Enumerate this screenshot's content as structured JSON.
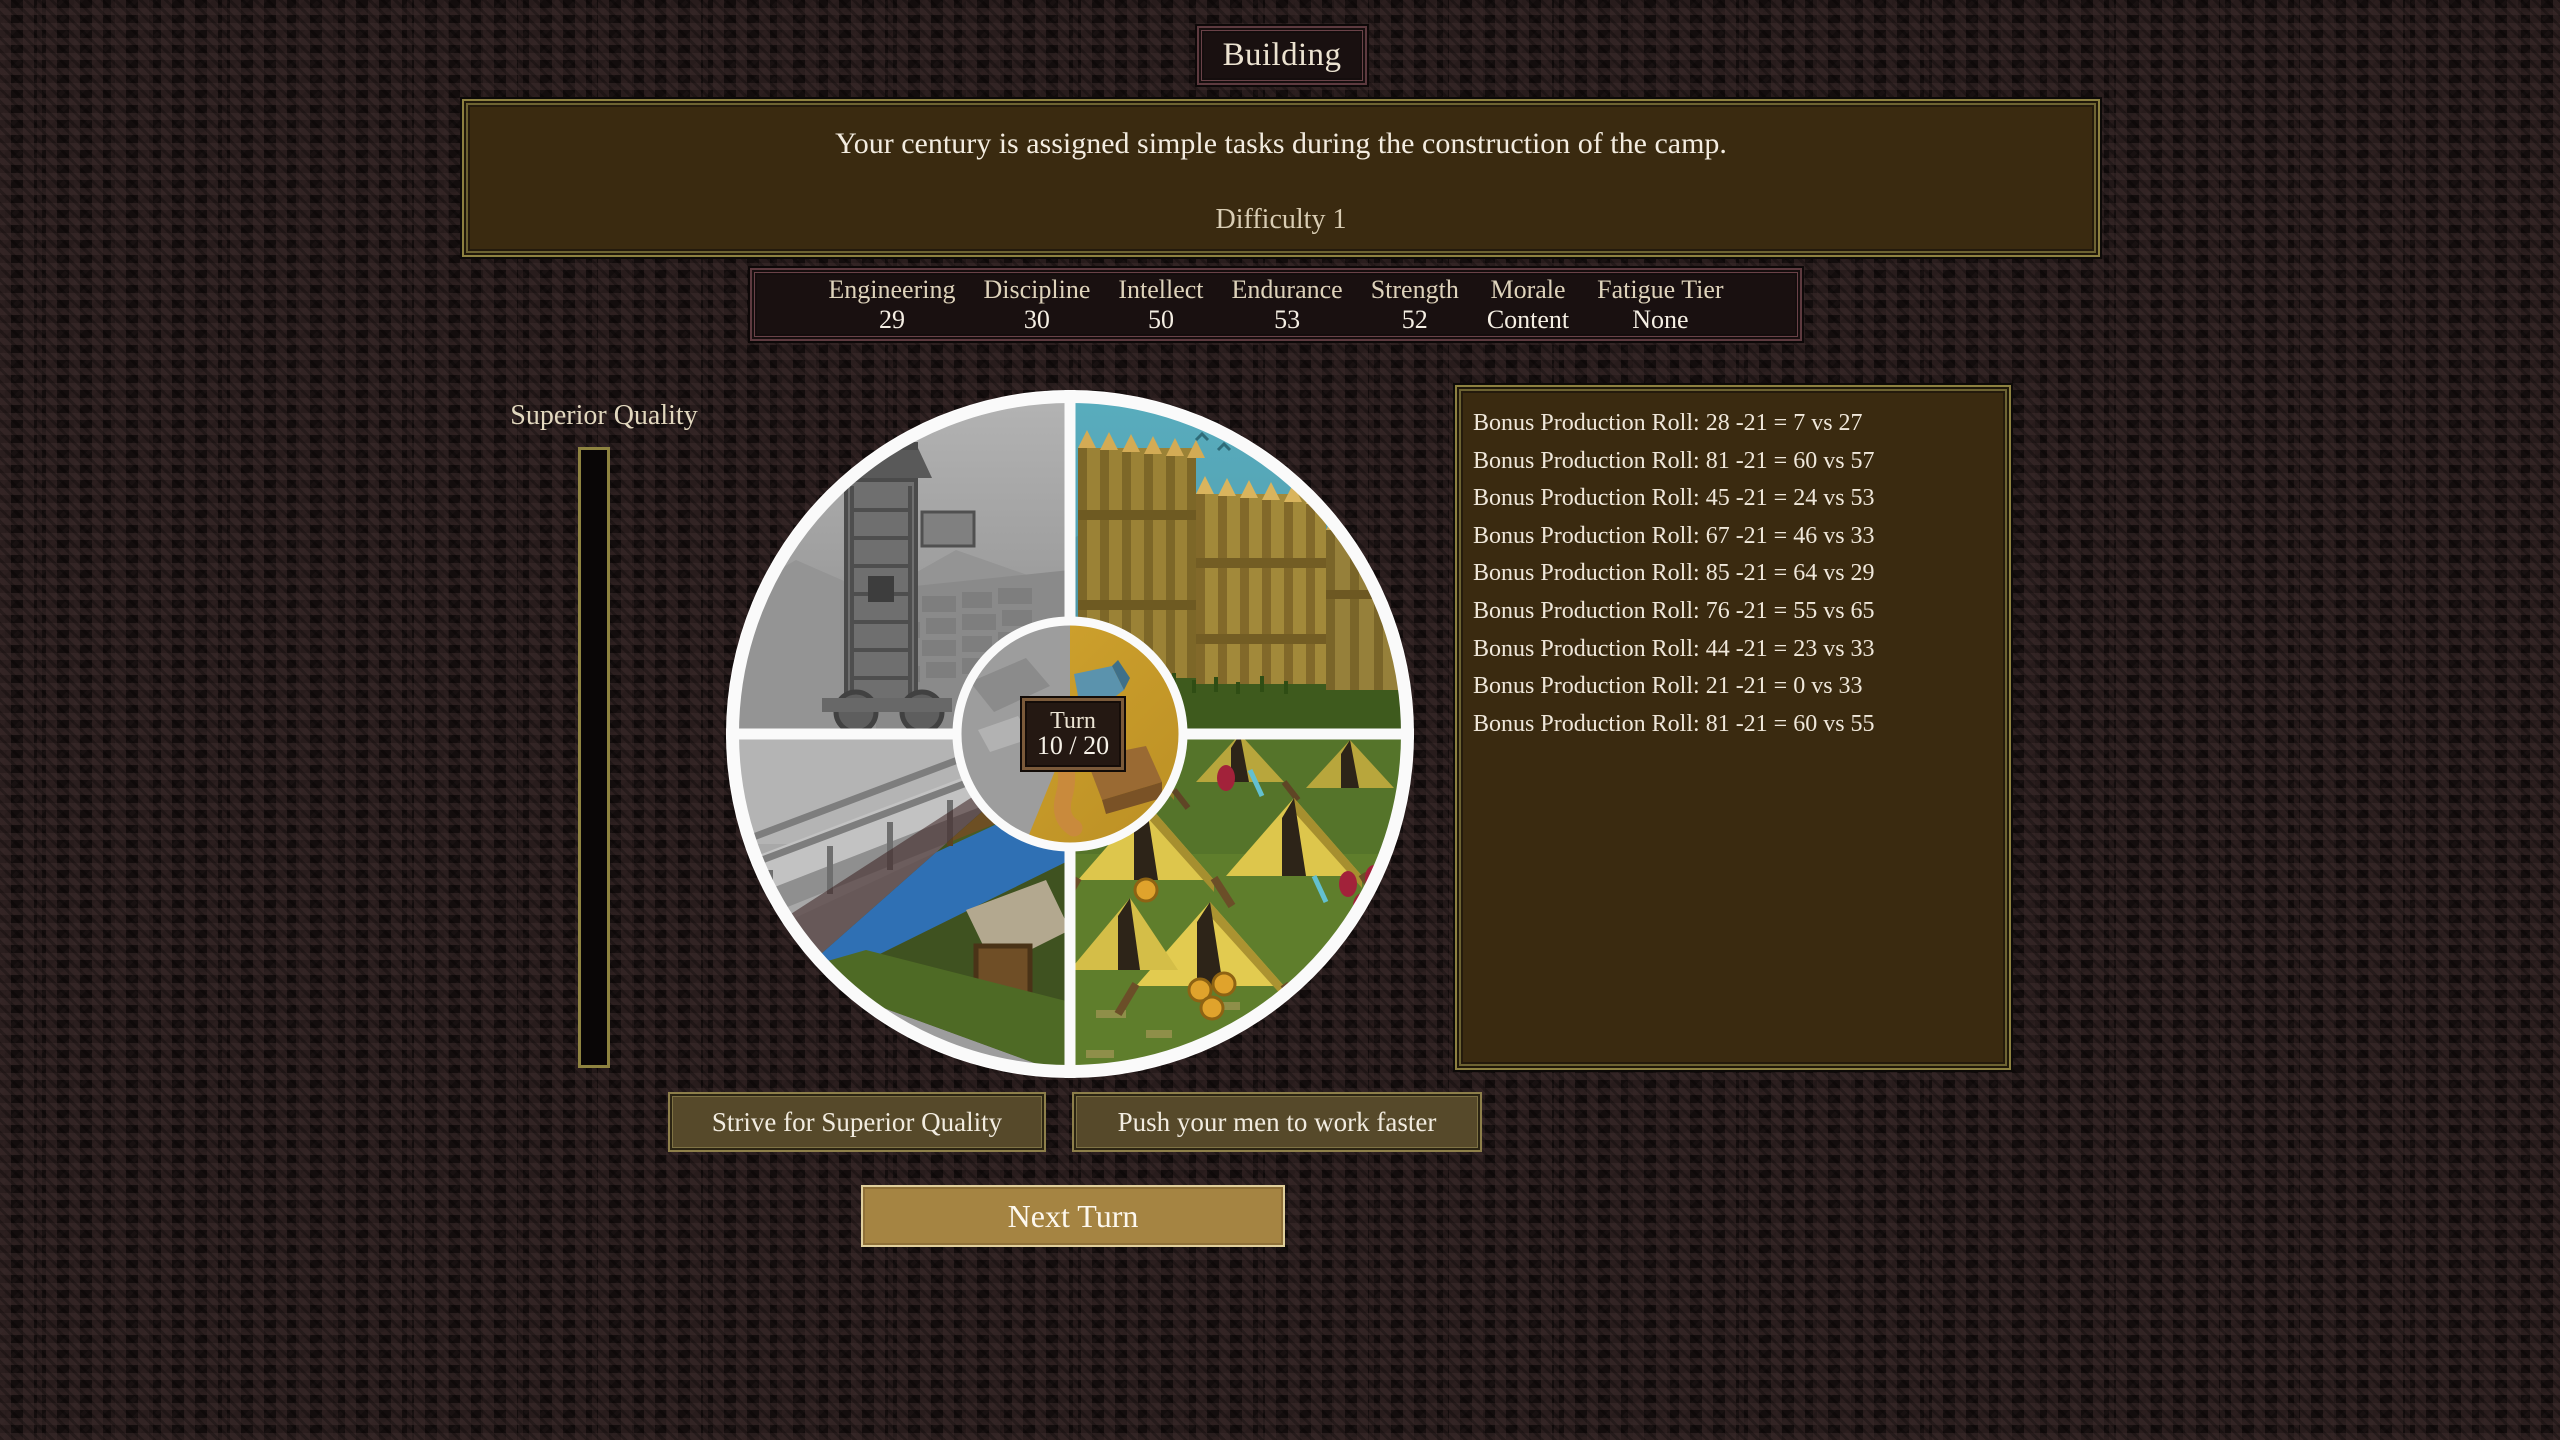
{
  "header": {
    "title": "Building"
  },
  "description": {
    "text": "Your century is assigned simple tasks during the construction of the camp.",
    "difficulty": "Difficulty 1"
  },
  "stats": {
    "columns": [
      {
        "name": "Engineering",
        "value": "29"
      },
      {
        "name": "Discipline",
        "value": "30"
      },
      {
        "name": "Intellect",
        "value": "50"
      },
      {
        "name": "Endurance",
        "value": "53"
      },
      {
        "name": "Strength",
        "value": "52"
      },
      {
        "name": "Morale",
        "value": "Content"
      },
      {
        "name": "Fatigue Tier",
        "value": "None"
      }
    ]
  },
  "quality_meter": {
    "label": "Superior Quality",
    "fill_percent": 0
  },
  "wheel": {
    "turn_word": "Turn",
    "turn_value": "10 / 20",
    "turn_current": 10,
    "turn_max": 20,
    "progress_percent": 54,
    "colors": {
      "ring": "#fafafa",
      "sky": "#5aa9b9",
      "grass": "#4c6b27",
      "tent": "#d9c44b",
      "center_gold": "#c69a2b",
      "stone": "#9a9a9a"
    }
  },
  "actions": {
    "quality": "Strive for Superior Quality",
    "faster": "Push your men to work faster",
    "next_turn": "Next Turn"
  },
  "log": {
    "lines": [
      "Bonus Production Roll: 28 -21 = 7 vs 27",
      "Bonus Production Roll: 81 -21 = 60 vs 57",
      "Bonus Production Roll: 45 -21 = 24 vs 53",
      "Bonus Production Roll: 67 -21 = 46 vs 33",
      "Bonus Production Roll: 85 -21 = 64 vs 29",
      "Bonus Production Roll: 76 -21 = 55 vs 65",
      "Bonus Production Roll: 44 -21 = 23 vs 33",
      "Bonus Production Roll: 21 -21 = 0 vs 33",
      "Bonus Production Roll: 81 -21 = 60 vs 55"
    ]
  }
}
